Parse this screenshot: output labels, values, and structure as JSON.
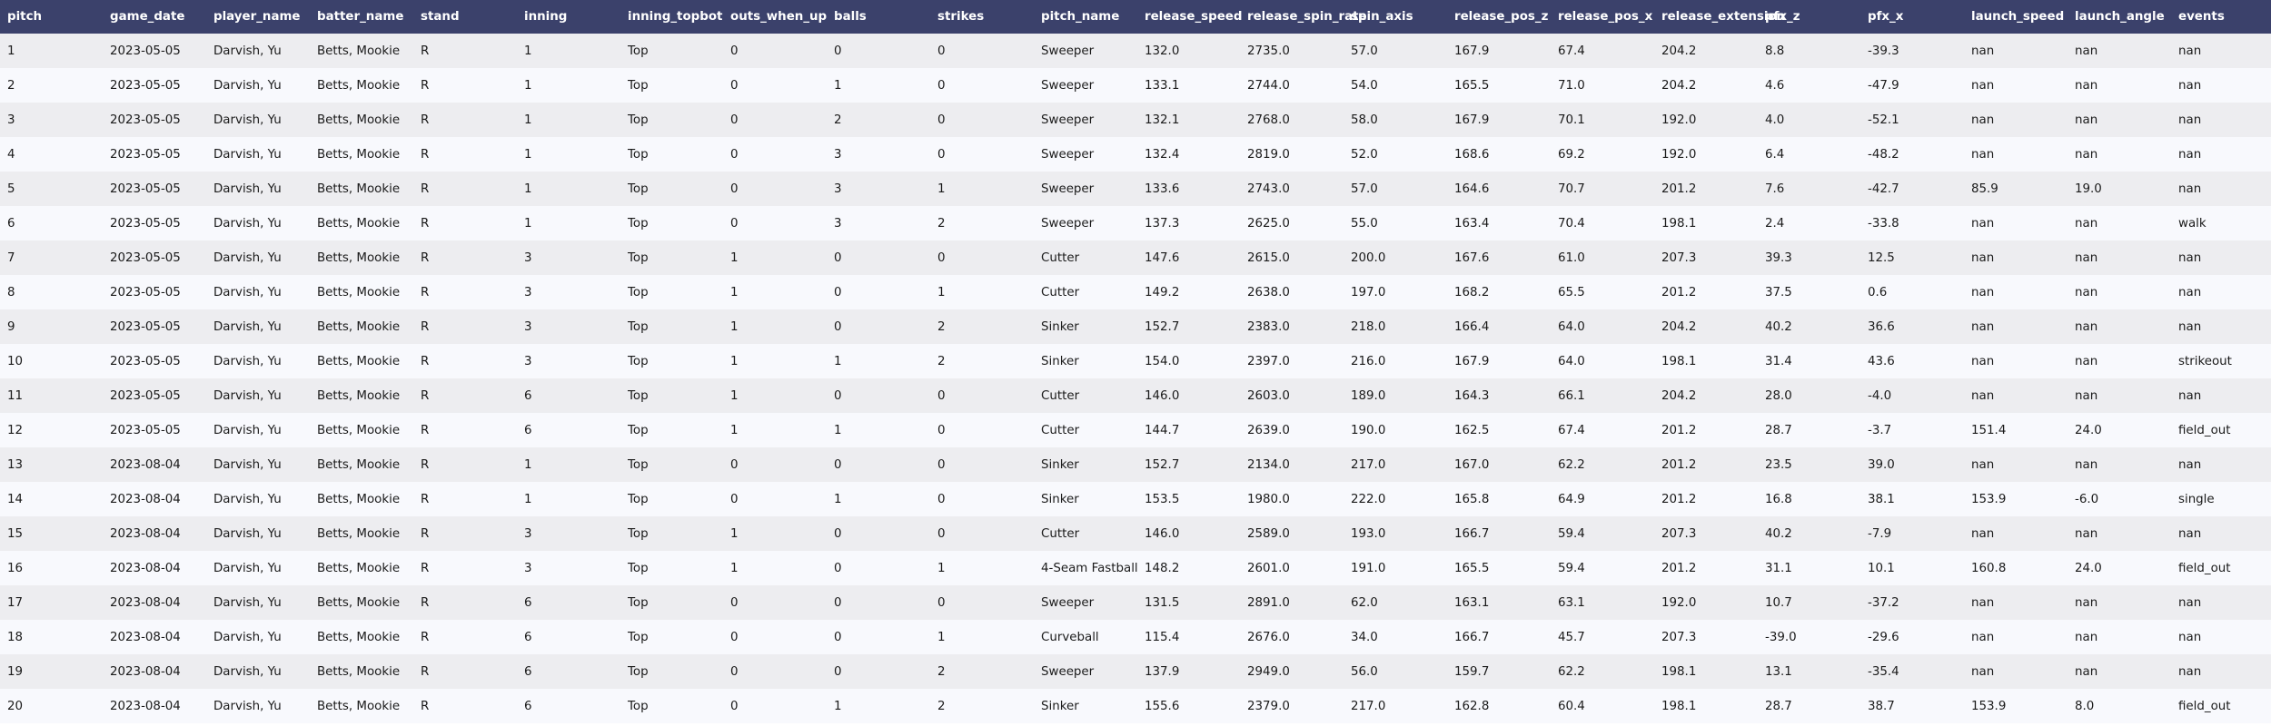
{
  "table": {
    "columns": [
      "pitch",
      "game_date",
      "player_name",
      "batter_name",
      "stand",
      "inning",
      "inning_topbot",
      "outs_when_up",
      "balls",
      "strikes",
      "pitch_name",
      "release_speed",
      "release_spin_rate",
      "spin_axis",
      "release_pos_z",
      "release_pos_x",
      "release_extension",
      "pfx_z",
      "pfx_x",
      "launch_speed",
      "launch_angle",
      "events"
    ],
    "rows": [
      [
        "1",
        "2023-05-05",
        "Darvish, Yu",
        "Betts, Mookie",
        "R",
        "1",
        "Top",
        "0",
        "0",
        "0",
        "Sweeper",
        "132.0",
        "2735.0",
        "57.0",
        "167.9",
        "67.4",
        "204.2",
        "8.8",
        "-39.3",
        "nan",
        "nan",
        "nan"
      ],
      [
        "2",
        "2023-05-05",
        "Darvish, Yu",
        "Betts, Mookie",
        "R",
        "1",
        "Top",
        "0",
        "1",
        "0",
        "Sweeper",
        "133.1",
        "2744.0",
        "54.0",
        "165.5",
        "71.0",
        "204.2",
        "4.6",
        "-47.9",
        "nan",
        "nan",
        "nan"
      ],
      [
        "3",
        "2023-05-05",
        "Darvish, Yu",
        "Betts, Mookie",
        "R",
        "1",
        "Top",
        "0",
        "2",
        "0",
        "Sweeper",
        "132.1",
        "2768.0",
        "58.0",
        "167.9",
        "70.1",
        "192.0",
        "4.0",
        "-52.1",
        "nan",
        "nan",
        "nan"
      ],
      [
        "4",
        "2023-05-05",
        "Darvish, Yu",
        "Betts, Mookie",
        "R",
        "1",
        "Top",
        "0",
        "3",
        "0",
        "Sweeper",
        "132.4",
        "2819.0",
        "52.0",
        "168.6",
        "69.2",
        "192.0",
        "6.4",
        "-48.2",
        "nan",
        "nan",
        "nan"
      ],
      [
        "5",
        "2023-05-05",
        "Darvish, Yu",
        "Betts, Mookie",
        "R",
        "1",
        "Top",
        "0",
        "3",
        "1",
        "Sweeper",
        "133.6",
        "2743.0",
        "57.0",
        "164.6",
        "70.7",
        "201.2",
        "7.6",
        "-42.7",
        "85.9",
        "19.0",
        "nan"
      ],
      [
        "6",
        "2023-05-05",
        "Darvish, Yu",
        "Betts, Mookie",
        "R",
        "1",
        "Top",
        "0",
        "3",
        "2",
        "Sweeper",
        "137.3",
        "2625.0",
        "55.0",
        "163.4",
        "70.4",
        "198.1",
        "2.4",
        "-33.8",
        "nan",
        "nan",
        "walk"
      ],
      [
        "7",
        "2023-05-05",
        "Darvish, Yu",
        "Betts, Mookie",
        "R",
        "3",
        "Top",
        "1",
        "0",
        "0",
        "Cutter",
        "147.6",
        "2615.0",
        "200.0",
        "167.6",
        "61.0",
        "207.3",
        "39.3",
        "12.5",
        "nan",
        "nan",
        "nan"
      ],
      [
        "8",
        "2023-05-05",
        "Darvish, Yu",
        "Betts, Mookie",
        "R",
        "3",
        "Top",
        "1",
        "0",
        "1",
        "Cutter",
        "149.2",
        "2638.0",
        "197.0",
        "168.2",
        "65.5",
        "201.2",
        "37.5",
        "0.6",
        "nan",
        "nan",
        "nan"
      ],
      [
        "9",
        "2023-05-05",
        "Darvish, Yu",
        "Betts, Mookie",
        "R",
        "3",
        "Top",
        "1",
        "0",
        "2",
        "Sinker",
        "152.7",
        "2383.0",
        "218.0",
        "166.4",
        "64.0",
        "204.2",
        "40.2",
        "36.6",
        "nan",
        "nan",
        "nan"
      ],
      [
        "10",
        "2023-05-05",
        "Darvish, Yu",
        "Betts, Mookie",
        "R",
        "3",
        "Top",
        "1",
        "1",
        "2",
        "Sinker",
        "154.0",
        "2397.0",
        "216.0",
        "167.9",
        "64.0",
        "198.1",
        "31.4",
        "43.6",
        "nan",
        "nan",
        "strikeout"
      ],
      [
        "11",
        "2023-05-05",
        "Darvish, Yu",
        "Betts, Mookie",
        "R",
        "6",
        "Top",
        "1",
        "0",
        "0",
        "Cutter",
        "146.0",
        "2603.0",
        "189.0",
        "164.3",
        "66.1",
        "204.2",
        "28.0",
        "-4.0",
        "nan",
        "nan",
        "nan"
      ],
      [
        "12",
        "2023-05-05",
        "Darvish, Yu",
        "Betts, Mookie",
        "R",
        "6",
        "Top",
        "1",
        "1",
        "0",
        "Cutter",
        "144.7",
        "2639.0",
        "190.0",
        "162.5",
        "67.4",
        "201.2",
        "28.7",
        "-3.7",
        "151.4",
        "24.0",
        "field_out"
      ],
      [
        "13",
        "2023-08-04",
        "Darvish, Yu",
        "Betts, Mookie",
        "R",
        "1",
        "Top",
        "0",
        "0",
        "0",
        "Sinker",
        "152.7",
        "2134.0",
        "217.0",
        "167.0",
        "62.2",
        "201.2",
        "23.5",
        "39.0",
        "nan",
        "nan",
        "nan"
      ],
      [
        "14",
        "2023-08-04",
        "Darvish, Yu",
        "Betts, Mookie",
        "R",
        "1",
        "Top",
        "0",
        "1",
        "0",
        "Sinker",
        "153.5",
        "1980.0",
        "222.0",
        "165.8",
        "64.9",
        "201.2",
        "16.8",
        "38.1",
        "153.9",
        "-6.0",
        "single"
      ],
      [
        "15",
        "2023-08-04",
        "Darvish, Yu",
        "Betts, Mookie",
        "R",
        "3",
        "Top",
        "1",
        "0",
        "0",
        "Cutter",
        "146.0",
        "2589.0",
        "193.0",
        "166.7",
        "59.4",
        "207.3",
        "40.2",
        "-7.9",
        "nan",
        "nan",
        "nan"
      ],
      [
        "16",
        "2023-08-04",
        "Darvish, Yu",
        "Betts, Mookie",
        "R",
        "3",
        "Top",
        "1",
        "0",
        "1",
        "4-Seam Fastball",
        "148.2",
        "2601.0",
        "191.0",
        "165.5",
        "59.4",
        "201.2",
        "31.1",
        "10.1",
        "160.8",
        "24.0",
        "field_out"
      ],
      [
        "17",
        "2023-08-04",
        "Darvish, Yu",
        "Betts, Mookie",
        "R",
        "6",
        "Top",
        "0",
        "0",
        "0",
        "Sweeper",
        "131.5",
        "2891.0",
        "62.0",
        "163.1",
        "63.1",
        "192.0",
        "10.7",
        "-37.2",
        "nan",
        "nan",
        "nan"
      ],
      [
        "18",
        "2023-08-04",
        "Darvish, Yu",
        "Betts, Mookie",
        "R",
        "6",
        "Top",
        "0",
        "0",
        "1",
        "Curveball",
        "115.4",
        "2676.0",
        "34.0",
        "166.7",
        "45.7",
        "207.3",
        "-39.0",
        "-29.6",
        "nan",
        "nan",
        "nan"
      ],
      [
        "19",
        "2023-08-04",
        "Darvish, Yu",
        "Betts, Mookie",
        "R",
        "6",
        "Top",
        "0",
        "0",
        "2",
        "Sweeper",
        "137.9",
        "2949.0",
        "56.0",
        "159.7",
        "62.2",
        "198.1",
        "13.1",
        "-35.4",
        "nan",
        "nan",
        "nan"
      ],
      [
        "20",
        "2023-08-04",
        "Darvish, Yu",
        "Betts, Mookie",
        "R",
        "6",
        "Top",
        "0",
        "1",
        "2",
        "Sinker",
        "155.6",
        "2379.0",
        "217.0",
        "162.8",
        "60.4",
        "198.1",
        "28.7",
        "38.7",
        "153.9",
        "8.0",
        "field_out"
      ]
    ]
  }
}
